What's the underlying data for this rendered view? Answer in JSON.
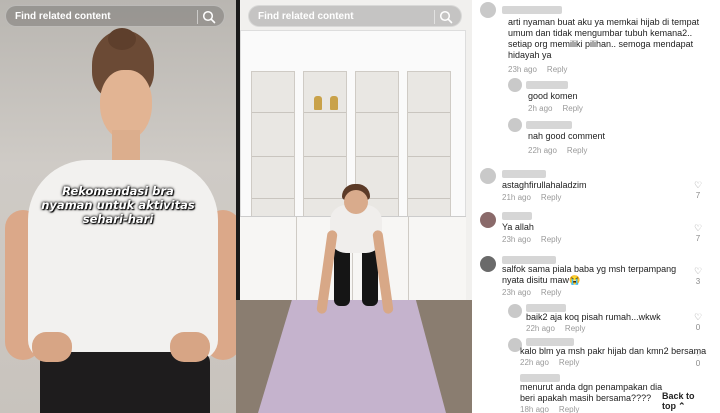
{
  "search_left": {
    "label": "Find related content"
  },
  "search_right": {
    "label": "Find related content"
  },
  "video_left": {
    "caption_lines": [
      "Rekomendasi bra",
      "nyaman untuk aktivitas",
      "sehari-hari"
    ]
  },
  "comments": [
    {
      "text": "arti nyaman buat aku ya memkai hijab di tempat umum dan tidak mengumbar tubuh kemana2.. setiap org memiliki pilihan.. semoga mendapat hidayah ya",
      "time": "23h ago",
      "reply": "Reply"
    },
    {
      "text": "good komen",
      "time": "2h ago",
      "reply": "Reply"
    },
    {
      "text": "nah good comment",
      "time": "22h ago",
      "reply": "Reply"
    },
    {
      "text": "astaghfirullahaladzim",
      "time": "21h ago",
      "reply": "Reply",
      "likes": "7"
    },
    {
      "text": "Ya allah",
      "time": "23h ago",
      "reply": "Reply",
      "likes": "7"
    },
    {
      "text": "salfok sama piala baba yg msh terpampang nyata disitu maw😭",
      "time": "23h ago",
      "reply": "Reply",
      "likes": "3"
    },
    {
      "text": "baik2 aja koq pisah rumah...wkwk",
      "time": "22h ago",
      "reply": "Reply",
      "likes": "0"
    },
    {
      "text": "kalo blm ya msh pakr hijab dan kmn2 bersama",
      "time": "22h ago",
      "reply": "Reply",
      "likes": "0"
    },
    {
      "text": "menurut anda dgn penampakan dia beri apakah masih bersama????",
      "time": "18h ago",
      "reply": "Reply"
    }
  ],
  "back_to_top": "Back to top"
}
